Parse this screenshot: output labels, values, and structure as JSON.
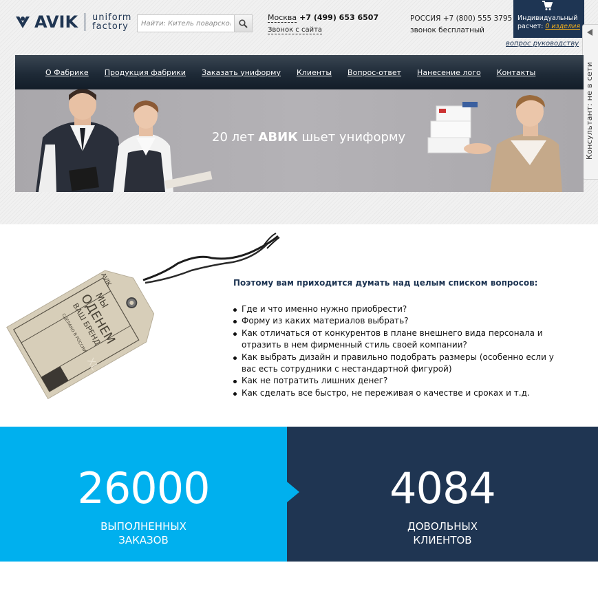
{
  "header": {
    "logo_word": "AVIK",
    "logo_sub_line1": "uniform",
    "logo_sub_line2": "factory",
    "search_placeholder": "Найти: Китель поварской",
    "city": "Москва",
    "phone": "+7 (499) 653 6507",
    "callback": "Звонок с сайта",
    "russia_line": "РОССИЯ +7 (800) 555 3795",
    "free_call": "звонок бесплатный",
    "cart_line1": "Индивидуальный",
    "cart_line2": "расчет:",
    "cart_count": "0 изделия",
    "manager_link": "вопрос руководству"
  },
  "consultant": {
    "label": "Консультант: не в сети"
  },
  "nav": {
    "items": [
      {
        "label": "О Фабрике"
      },
      {
        "label": "Продукция фабрики"
      },
      {
        "label": "Заказать униформу"
      },
      {
        "label": "Клиенты"
      },
      {
        "label": "Вопрос-ответ"
      },
      {
        "label": "Нанесение лого"
      },
      {
        "label": "Контакты"
      }
    ]
  },
  "banner": {
    "text_pre": "20 лет ",
    "text_bold": "АВИК",
    "text_post": " шьет униформу"
  },
  "tag_image": {
    "brand": "AVIK",
    "line1": "МЫ",
    "line2": "ОДЕНЕМ",
    "line3": "ВАШ БРЕНД",
    "made": "СДЕЛАНО В РОССИИ",
    "size": "XL"
  },
  "questions": {
    "title": "Поэтому вам приходится думать над целым списком вопросов:",
    "items": [
      "Где и что именно нужно приобрести?",
      "Форму из каких материалов выбрать?",
      "Как отличаться от конкурентов в плане внешнего вида персонала и отразить в нем фирменный стиль своей компании?",
      "Как выбрать дизайн и правильно подобрать размеры (особенно если у вас есть сотрудники с нестандартной фигурой)",
      "Как не потратить лишних денег?",
      "Как сделать все быстро, не переживая о качестве и сроках и т.д."
    ]
  },
  "stats": {
    "orders_value": "26000",
    "orders_line1": "ВЫПОЛНЕННЫХ",
    "orders_line2": "ЗАКАЗОВ",
    "clients_value": "4084",
    "clients_line1": "ДОВОЛЬНЫХ",
    "clients_line2": "КЛИЕНТОВ"
  },
  "colors": {
    "brand_navy": "#1f3552",
    "accent_blue": "#00b0ee",
    "accent_orange": "#f6b21b"
  }
}
